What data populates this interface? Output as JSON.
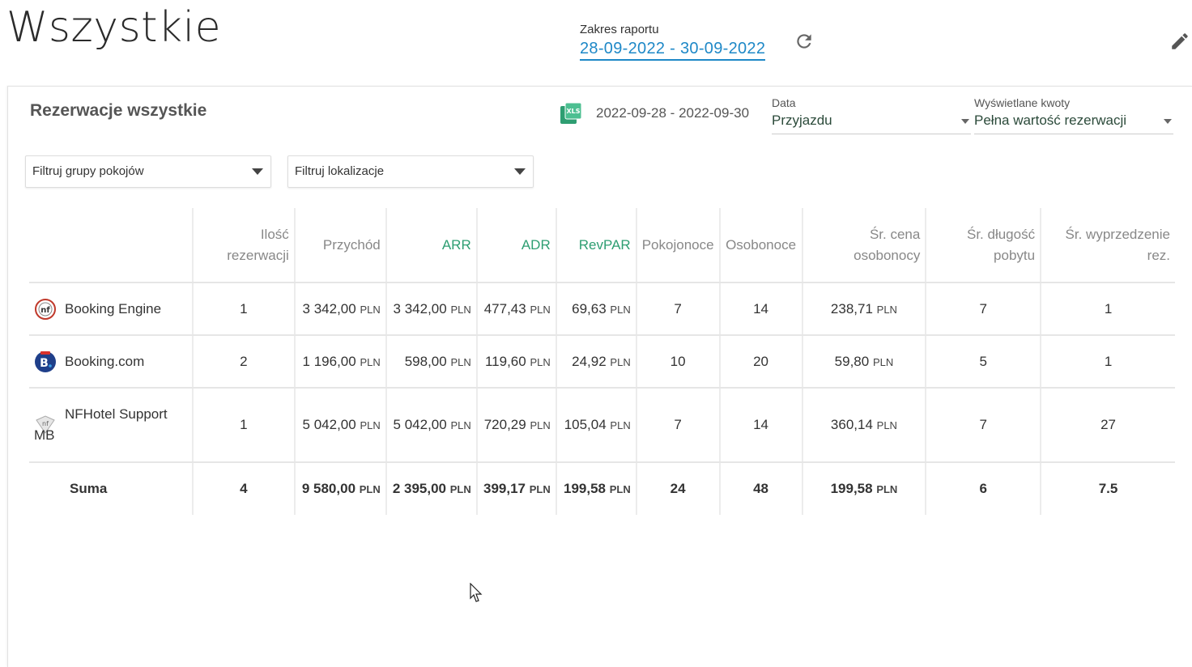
{
  "page": {
    "title": "Wszystkie",
    "report_range_label": "Zakres raportu",
    "report_range_value": "28-09-2022 - 30-09-2022"
  },
  "card": {
    "title": "Rezerwacje wszystkie",
    "date_range": "2022-09-28 - 2022-09-30",
    "data_select": {
      "label": "Data",
      "value": "Przyjazdu"
    },
    "kwoty_select": {
      "label": "Wyświetlane kwoty",
      "value": "Pełna wartość rezerwacji"
    },
    "filter_groups": "Filtruj grupy pokojów",
    "filter_locations": "Filtruj lokalizacje"
  },
  "table": {
    "headers": [
      "",
      "Ilość rezerwacji",
      "Przychód",
      "ARR",
      "ADR",
      "RevPAR",
      "Pokojonoce",
      "Osobonoce",
      "Śr. cena osobonocy",
      "Śr. długość pobytu",
      "Śr. wyprzedzenie rez."
    ],
    "unit": "PLN",
    "rows": [
      {
        "source": "Booking Engine",
        "icon": "booking-engine-icon",
        "ilosc": "1",
        "przychod": "3 342,00",
        "arr": "3 342,00",
        "adr": "477,43",
        "revpar": "69,63",
        "pokojonoce": "7",
        "osobonoce": "14",
        "cena": "238,71",
        "dlugosc": "7",
        "wyprzedzenie": "1"
      },
      {
        "source": "Booking.com",
        "icon": "booking-com-icon",
        "ilosc": "2",
        "przychod": "1 196,00",
        "arr": "598,00",
        "adr": "119,60",
        "revpar": "24,92",
        "pokojonoce": "10",
        "osobonoce": "20",
        "cena": "59,80",
        "dlugosc": "5",
        "wyprzedzenie": "1"
      },
      {
        "source": "NFHotel Support MB",
        "icon": "nfhotel-icon",
        "ilosc": "1",
        "przychod": "5 042,00",
        "arr": "5 042,00",
        "adr": "720,29",
        "revpar": "105,04",
        "pokojonoce": "7",
        "osobonoce": "14",
        "cena": "360,14",
        "dlugosc": "7",
        "wyprzedzenie": "27"
      }
    ],
    "sum": {
      "label": "Suma",
      "ilosc": "4",
      "przychod": "9 580,00",
      "arr": "2 395,00",
      "adr": "399,17",
      "revpar": "199,58",
      "pokojonoce": "24",
      "osobonoce": "48",
      "cena": "199,58",
      "dlugosc": "6",
      "wyprzedzenie": "7.5"
    }
  },
  "colors": {
    "accent_blue": "#1e88c7",
    "accent_green": "#2e9e72"
  }
}
